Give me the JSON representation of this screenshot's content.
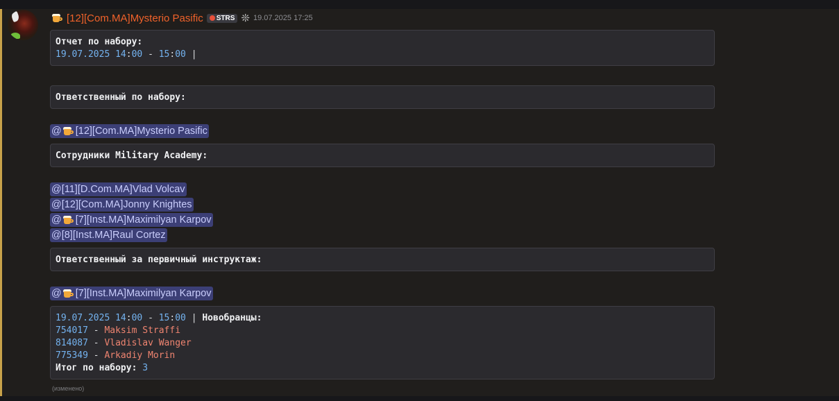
{
  "message": {
    "author": "[12][Com.MA]Mysterio Pasific",
    "tag": "STRS",
    "timestamp": "19.07.2025 17:25",
    "edited": "(изменено)"
  },
  "blocks": {
    "report_title": "Отчет по набору:",
    "report_date": "19.07.2025",
    "report_start_h": "14",
    "report_start_m": "00",
    "report_end_h": "15",
    "report_end_m": "00",
    "responsible_label": "Ответственный по набору:",
    "staff_label": "Сотрудники Military Academy:",
    "instructor_label": "Ответственный за первичный инструктаж:",
    "recruits_date": "19.07.2025",
    "recruits_start_h": "14",
    "recruits_start_m": "00",
    "recruits_end_h": "15",
    "recruits_end_m": "00",
    "recruits_label": "Новобранцы:",
    "recruits": [
      {
        "id": "754017",
        "name": "Maksim Straffi"
      },
      {
        "id": "814087",
        "name": "Vladislav Wanger"
      },
      {
        "id": "775349",
        "name": "Arkadiy Morin"
      }
    ],
    "total_label": "Итог по набору:",
    "total_value": "3"
  },
  "mentions": {
    "responsible": "[12][Com.MA]Mysterio Pasific",
    "staff": [
      {
        "text": "@[11][D.Com.MA]Vlad Volcav",
        "emoji": false
      },
      {
        "text": "@[12][Com.MA]Jonny Knightes",
        "emoji": false
      },
      {
        "text": "[7][Inst.MA]Maximilyan Karpov",
        "emoji": true
      },
      {
        "text": "@[8][Inst.MA]Raul Cortez",
        "emoji": false
      }
    ],
    "instructor": "[7][Inst.MA]Maximilyan Karpov"
  },
  "colors": {
    "username": "#f0622a",
    "mention_bg": "#3c3f76",
    "mention_text": "#c9cdfb",
    "number": "#74b3f0",
    "recruit_name": "#ef8470",
    "accent_stripe": "#c8a24a"
  }
}
